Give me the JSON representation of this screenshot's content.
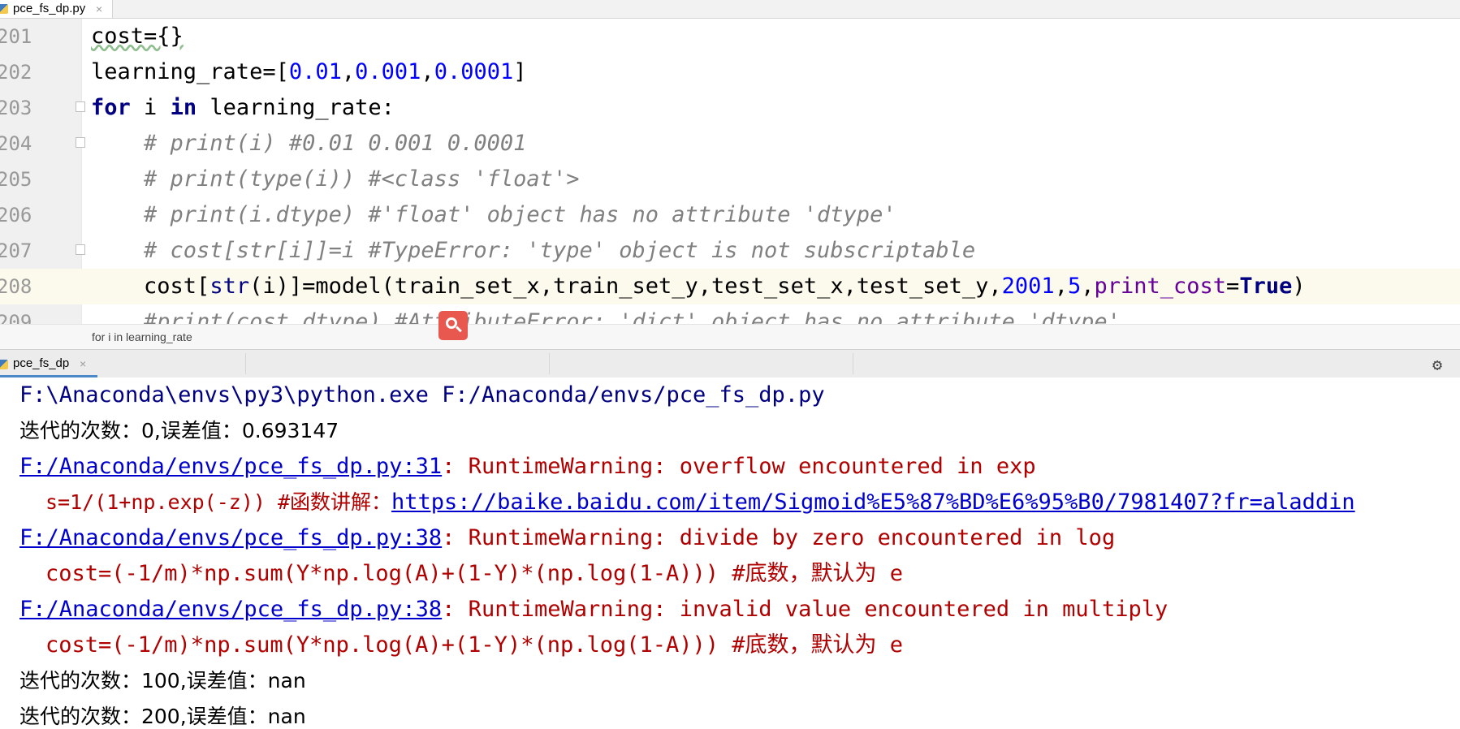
{
  "editor_tab": {
    "label": "pce_fs_dp.py"
  },
  "code_lines": [
    {
      "num": "201",
      "text": "cost={}"
    },
    {
      "num": "202",
      "pre": "learning_rate=[",
      "n1": "0.01",
      "c1": ",",
      "n2": "0.001",
      "c2": ",",
      "n3": "0.0001",
      "post": "]"
    },
    {
      "num": "203",
      "kw1": "for",
      "mid1": " i ",
      "kw2": "in",
      "rest": " learning_rate:"
    },
    {
      "num": "204",
      "text": "    # print(i) #0.01 0.001 0.0001"
    },
    {
      "num": "205",
      "text": "    # print(type(i)) #<class 'float'>"
    },
    {
      "num": "206",
      "text": "    # print(i.dtype) #'float' object has no attribute 'dtype'"
    },
    {
      "num": "207",
      "text": "    # cost[str[i]]=i #TypeError: 'type' object is not subscriptable"
    },
    {
      "num": "208",
      "p1": "    cost[",
      "fn": "str",
      "p2": "(i)]=model(train_set_x,train_set_y,test_set_x,test_set_y,",
      "n1": "2001",
      "c1": ",",
      "n2": "5",
      "c2": ",",
      "kwarg": "print_cost",
      "eq": "=",
      "kwv": "True",
      "close": ")"
    },
    {
      "num": "209",
      "text": "    #print(cost.dtype) #AttributeError: 'dict' object has no attribute 'dtype'"
    }
  ],
  "breadcrumb": "for i in learning_rate",
  "run_tab": {
    "label": "pce_fs_dp"
  },
  "output": {
    "cmd": "F:\\Anaconda\\envs\\py3\\python.exe F:/Anaconda/envs/pce_fs_dp.py",
    "iter0": "迭代的次数：0,误差值：0.693147",
    "warn1_link": "F:/Anaconda/envs/pce_fs_dp.py:31",
    "warn1_msg": ": RuntimeWarning: overflow encountered in exp",
    "warn1_src_pre": "s=1/(1+np.exp(-z)) #函数讲解：",
    "warn1_src_link": "https://baike.baidu.com/item/Sigmoid%E5%87%BD%E6%95%B0/7981407?fr=aladdin",
    "warn2_link": "F:/Anaconda/envs/pce_fs_dp.py:38",
    "warn2_msg": ": RuntimeWarning: divide by zero encountered in log",
    "warn2_src": "cost=(-1/m)*np.sum(Y*np.log(A)+(1-Y)*(np.log(1-A))) #底数，默认为 e",
    "warn3_link": "F:/Anaconda/envs/pce_fs_dp.py:38",
    "warn3_msg": ": RuntimeWarning: invalid value encountered in multiply",
    "warn3_src": "cost=(-1/m)*np.sum(Y*np.log(A)+(1-Y)*(np.log(1-A))) #底数，默认为 e",
    "iter100": "迭代的次数：100,误差值：nan",
    "iter200": "迭代的次数：200,误差值：nan"
  }
}
